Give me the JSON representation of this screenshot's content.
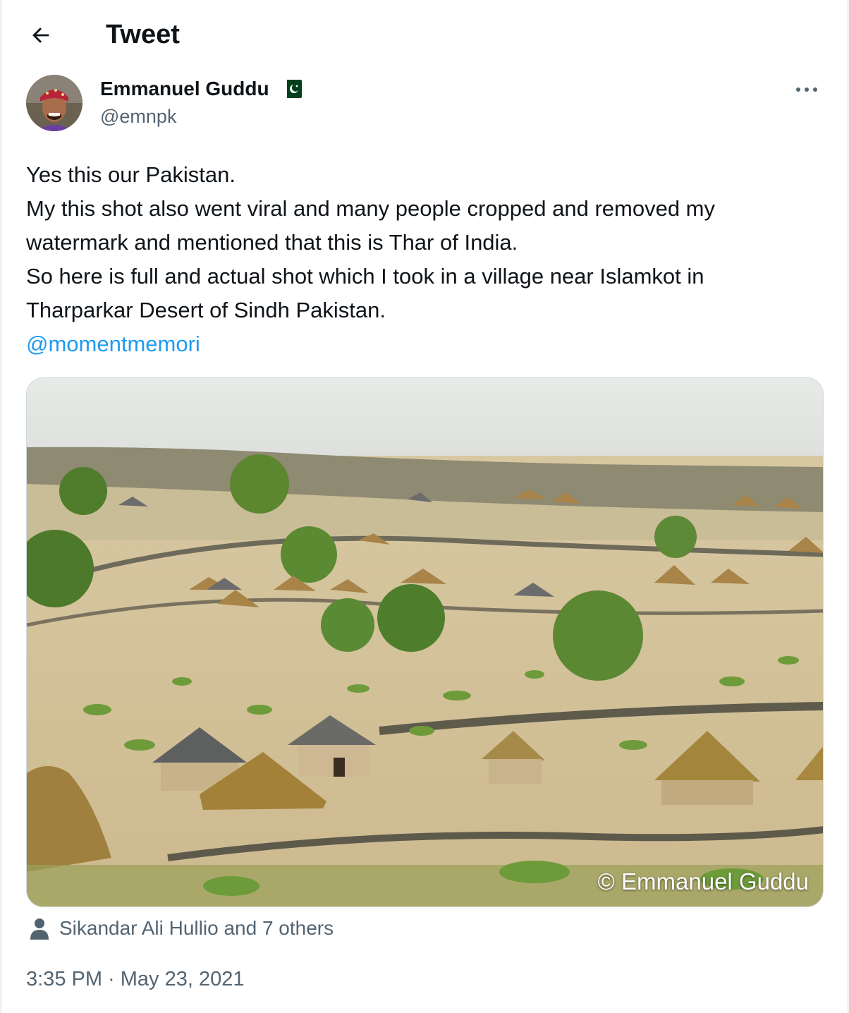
{
  "header": {
    "title": "Tweet",
    "back_icon": "arrow-left-icon"
  },
  "author": {
    "display_name": "Emmanuel Guddu",
    "handle": "@emnpk",
    "flag_icon": "pakistan-flag-icon"
  },
  "tweet": {
    "lines": [
      "Yes this our Pakistan.",
      "My this shot also went viral and many people cropped and removed my",
      "watermark and mentioned that this is Thar of India.",
      "So here is full and actual shot which I took in a village near Islamkot in",
      "Tharparkar Desert of Sindh Pakistan."
    ],
    "mention": "@momentmemori"
  },
  "media": {
    "watermark": "© Emmanuel Guddu"
  },
  "tagged": {
    "icon": "person-icon",
    "text": "Sikandar Ali Hullio and 7 others"
  },
  "meta": {
    "timestamp": "3:35 PM · May 23, 2021"
  },
  "colors": {
    "link": "#1d9bf0",
    "secondary_text": "#536471",
    "border": "#cfd9de"
  }
}
